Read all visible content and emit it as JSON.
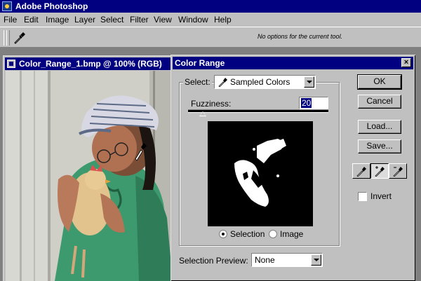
{
  "app": {
    "title": "Adobe Photoshop"
  },
  "menu": [
    "File",
    "Edit",
    "Image",
    "Layer",
    "Select",
    "Filter",
    "View",
    "Window",
    "Help"
  ],
  "options_bar": {
    "hint": "No options for the current tool."
  },
  "document": {
    "title": "Color_Range_1.bmp @ 100% (RGB)"
  },
  "dialog": {
    "title": "Color Range",
    "close": "×",
    "select_label": "Select:",
    "select_value": "Sampled Colors",
    "fuzziness_label": "Fuzziness:",
    "fuzziness_value": "20",
    "radio_selection": "Selection",
    "radio_image": "Image",
    "preview_label": "Selection Preview:",
    "preview_value": "None",
    "buttons": {
      "ok": "OK",
      "cancel": "Cancel",
      "load": "Load...",
      "save": "Save..."
    },
    "invert_label": "Invert"
  }
}
